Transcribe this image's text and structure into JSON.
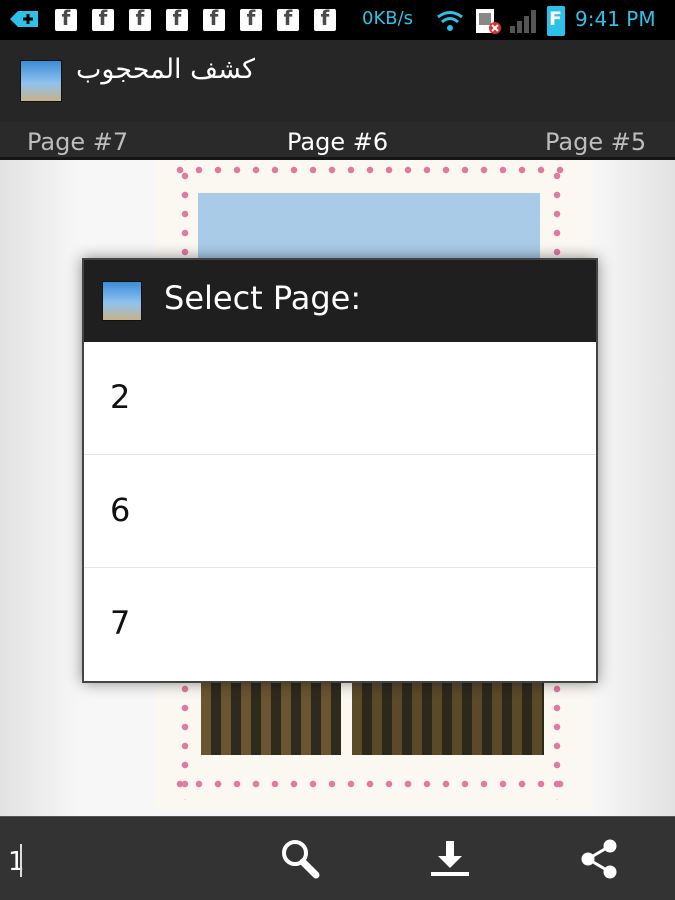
{
  "status_bar": {
    "net_speed": "0KB/s",
    "time": "9:41 PM",
    "battery_label": "F",
    "notification_icons": [
      "f",
      "f",
      "f",
      "f",
      "f",
      "f",
      "f",
      "f"
    ]
  },
  "app": {
    "title": "كشف المحجوب"
  },
  "page_tabs": {
    "prev": "Page #7",
    "current": "Page #6",
    "next": "Page #5"
  },
  "dialog": {
    "title": "Select Page:",
    "options": [
      "2",
      "6",
      "7"
    ]
  },
  "bottom_bar": {
    "page_input_value": "1"
  },
  "colors": {
    "accent": "#2cc1e8",
    "action_bar": "#262626",
    "dialog_header": "#1f1f1f",
    "page_border": "#e07aa0"
  },
  "icons": {
    "usb": "usb-icon",
    "notification": "facebook-icon",
    "wifi": "wifi-icon",
    "sim": "sim-card-icon",
    "signal": "signal-icon",
    "battery": "battery-icon",
    "search": "search-icon",
    "download": "download-icon",
    "share": "share-icon"
  }
}
